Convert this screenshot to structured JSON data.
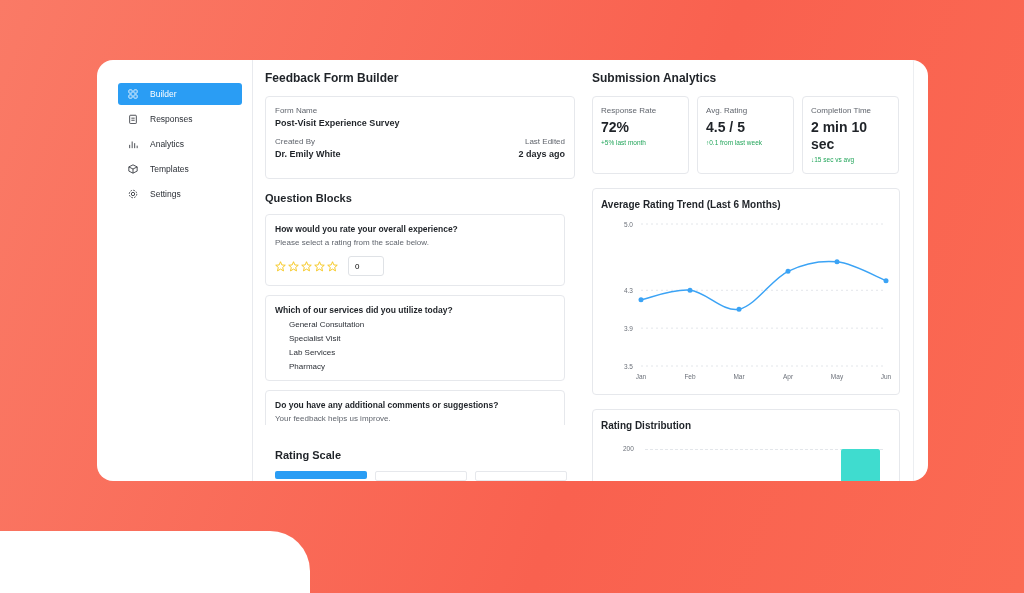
{
  "sidebar": {
    "items": [
      {
        "label": "Builder",
        "selected": true
      },
      {
        "label": "Responses",
        "selected": false
      },
      {
        "label": "Analytics",
        "selected": false
      },
      {
        "label": "Templates",
        "selected": false
      },
      {
        "label": "Settings",
        "selected": false
      }
    ]
  },
  "builder": {
    "title": "Feedback Form Builder",
    "form": {
      "name_label": "Form Name",
      "name": "Post-Visit Experience Survey",
      "created_label": "Created By",
      "created": "Dr. Emily White",
      "edited_label": "Last Edited",
      "edited": "2 days ago"
    },
    "blocks_title": "Question Blocks",
    "blocks": [
      {
        "kind": "rating",
        "question": "How would you rate your overall experience?",
        "hint": "Please select a rating from the scale below.",
        "stars": 0,
        "value": "0"
      },
      {
        "kind": "options",
        "question": "Which of our services did you utilize today?",
        "options": [
          "General Consultation",
          "Specialist Visit",
          "Lab Services",
          "Pharmacy"
        ]
      },
      {
        "kind": "text",
        "question": "Do you have any additional comments or suggestions?",
        "hint": "Your feedback helps us improve."
      }
    ],
    "scale_title": "Rating Scale",
    "scale_options": [
      {
        "selected": true
      },
      {
        "selected": false
      },
      {
        "selected": false
      }
    ]
  },
  "analytics": {
    "title": "Submission Analytics",
    "metrics": [
      {
        "label": "Response Rate",
        "value": "72%",
        "delta": "+5% last month"
      },
      {
        "label": "Avg. Rating",
        "value": "4.5 / 5",
        "delta": "↑0.1 from last week"
      },
      {
        "label": "Completion Time",
        "value": "2 min 10 sec",
        "delta": "↓15 sec vs avg"
      }
    ],
    "trend": {
      "title": "Average Rating Trend (Last 6 Months)",
      "chart_data": {
        "type": "line",
        "categories": [
          "Jan",
          "Feb",
          "Mar",
          "Apr",
          "May",
          "Jun"
        ],
        "series": [
          {
            "color": "#3ba3f5",
            "values": [
              4.2,
              4.3,
              4.1,
              4.5,
              4.6,
              4.4
            ]
          }
        ],
        "ylim": [
          3.5,
          5.0
        ],
        "yticks": [
          3.5,
          3.9,
          4.3,
          {
            "value": 5,
            "label": "5.0"
          }
        ]
      }
    },
    "distribution": {
      "title": "Rating Distribution",
      "tick": "200"
    }
  }
}
